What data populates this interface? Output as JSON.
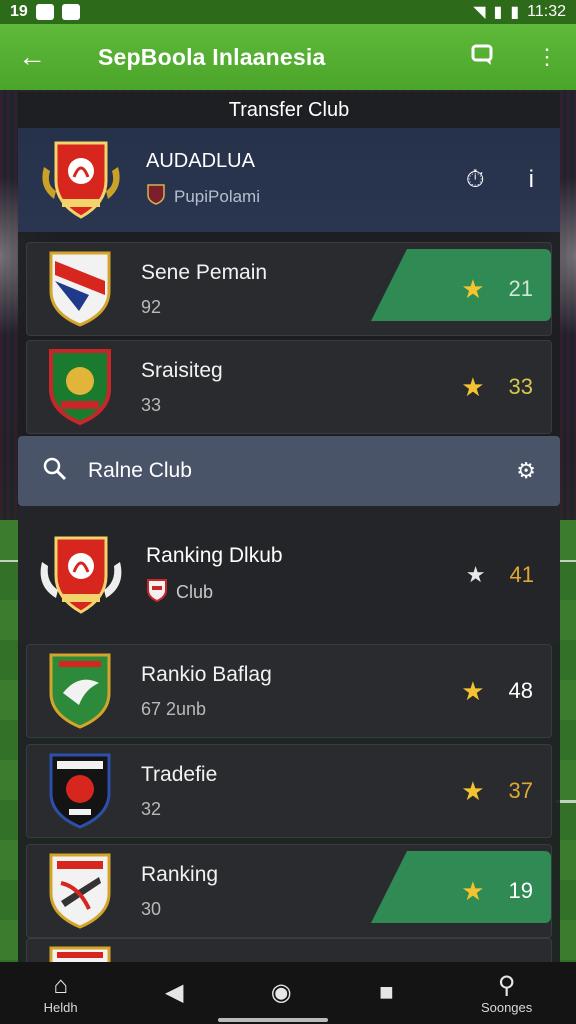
{
  "status_bar": {
    "left_text": "19",
    "time": "11:32"
  },
  "app_bar": {
    "title": "SepBoola Inlaanesia"
  },
  "panel": {
    "title": "Transfer Club"
  },
  "featured": {
    "name": "AUDADLUA",
    "subtitle": "PupiPolami"
  },
  "rows_top": [
    {
      "name": "Sene Pemain",
      "sub": "92",
      "score": "21",
      "highlight": true,
      "score_color": "#cfe6d6"
    },
    {
      "name": "Sraisiteg",
      "sub": "33",
      "score": "33",
      "highlight": false,
      "score_color": "#d6c84a"
    }
  ],
  "search": {
    "label": "Ralne Club"
  },
  "ranking_main": {
    "name": "Ranking Dlkub",
    "sub": "Club",
    "score": "41",
    "score_color": "#e0a830"
  },
  "rows_bottom": [
    {
      "name": "Rankio Baflag",
      "sub": "67  2unb",
      "score": "48",
      "highlight": false,
      "score_color": "#ffffff"
    },
    {
      "name": "Tradefie",
      "sub": "32",
      "score": "37",
      "highlight": false,
      "score_color": "#e0a830"
    },
    {
      "name": "Ranking",
      "sub": "30",
      "score": "19",
      "highlight": true,
      "score_color": "#ffffff"
    }
  ],
  "bottom_nav": {
    "home_label": "Heldh",
    "settings_label": "Soonges"
  },
  "colors": {
    "accent_green": "#4aa52a",
    "star": "#f4c430",
    "highlight_green": "#2f8a54"
  },
  "icons": [
    "back-arrow-icon",
    "message-icon",
    "more-vert-icon",
    "timer-icon",
    "info-icon",
    "star-icon",
    "search-icon",
    "gear-icon",
    "home-icon",
    "nav-back-icon",
    "nav-home-icon",
    "nav-recents-icon",
    "profile-icon"
  ]
}
